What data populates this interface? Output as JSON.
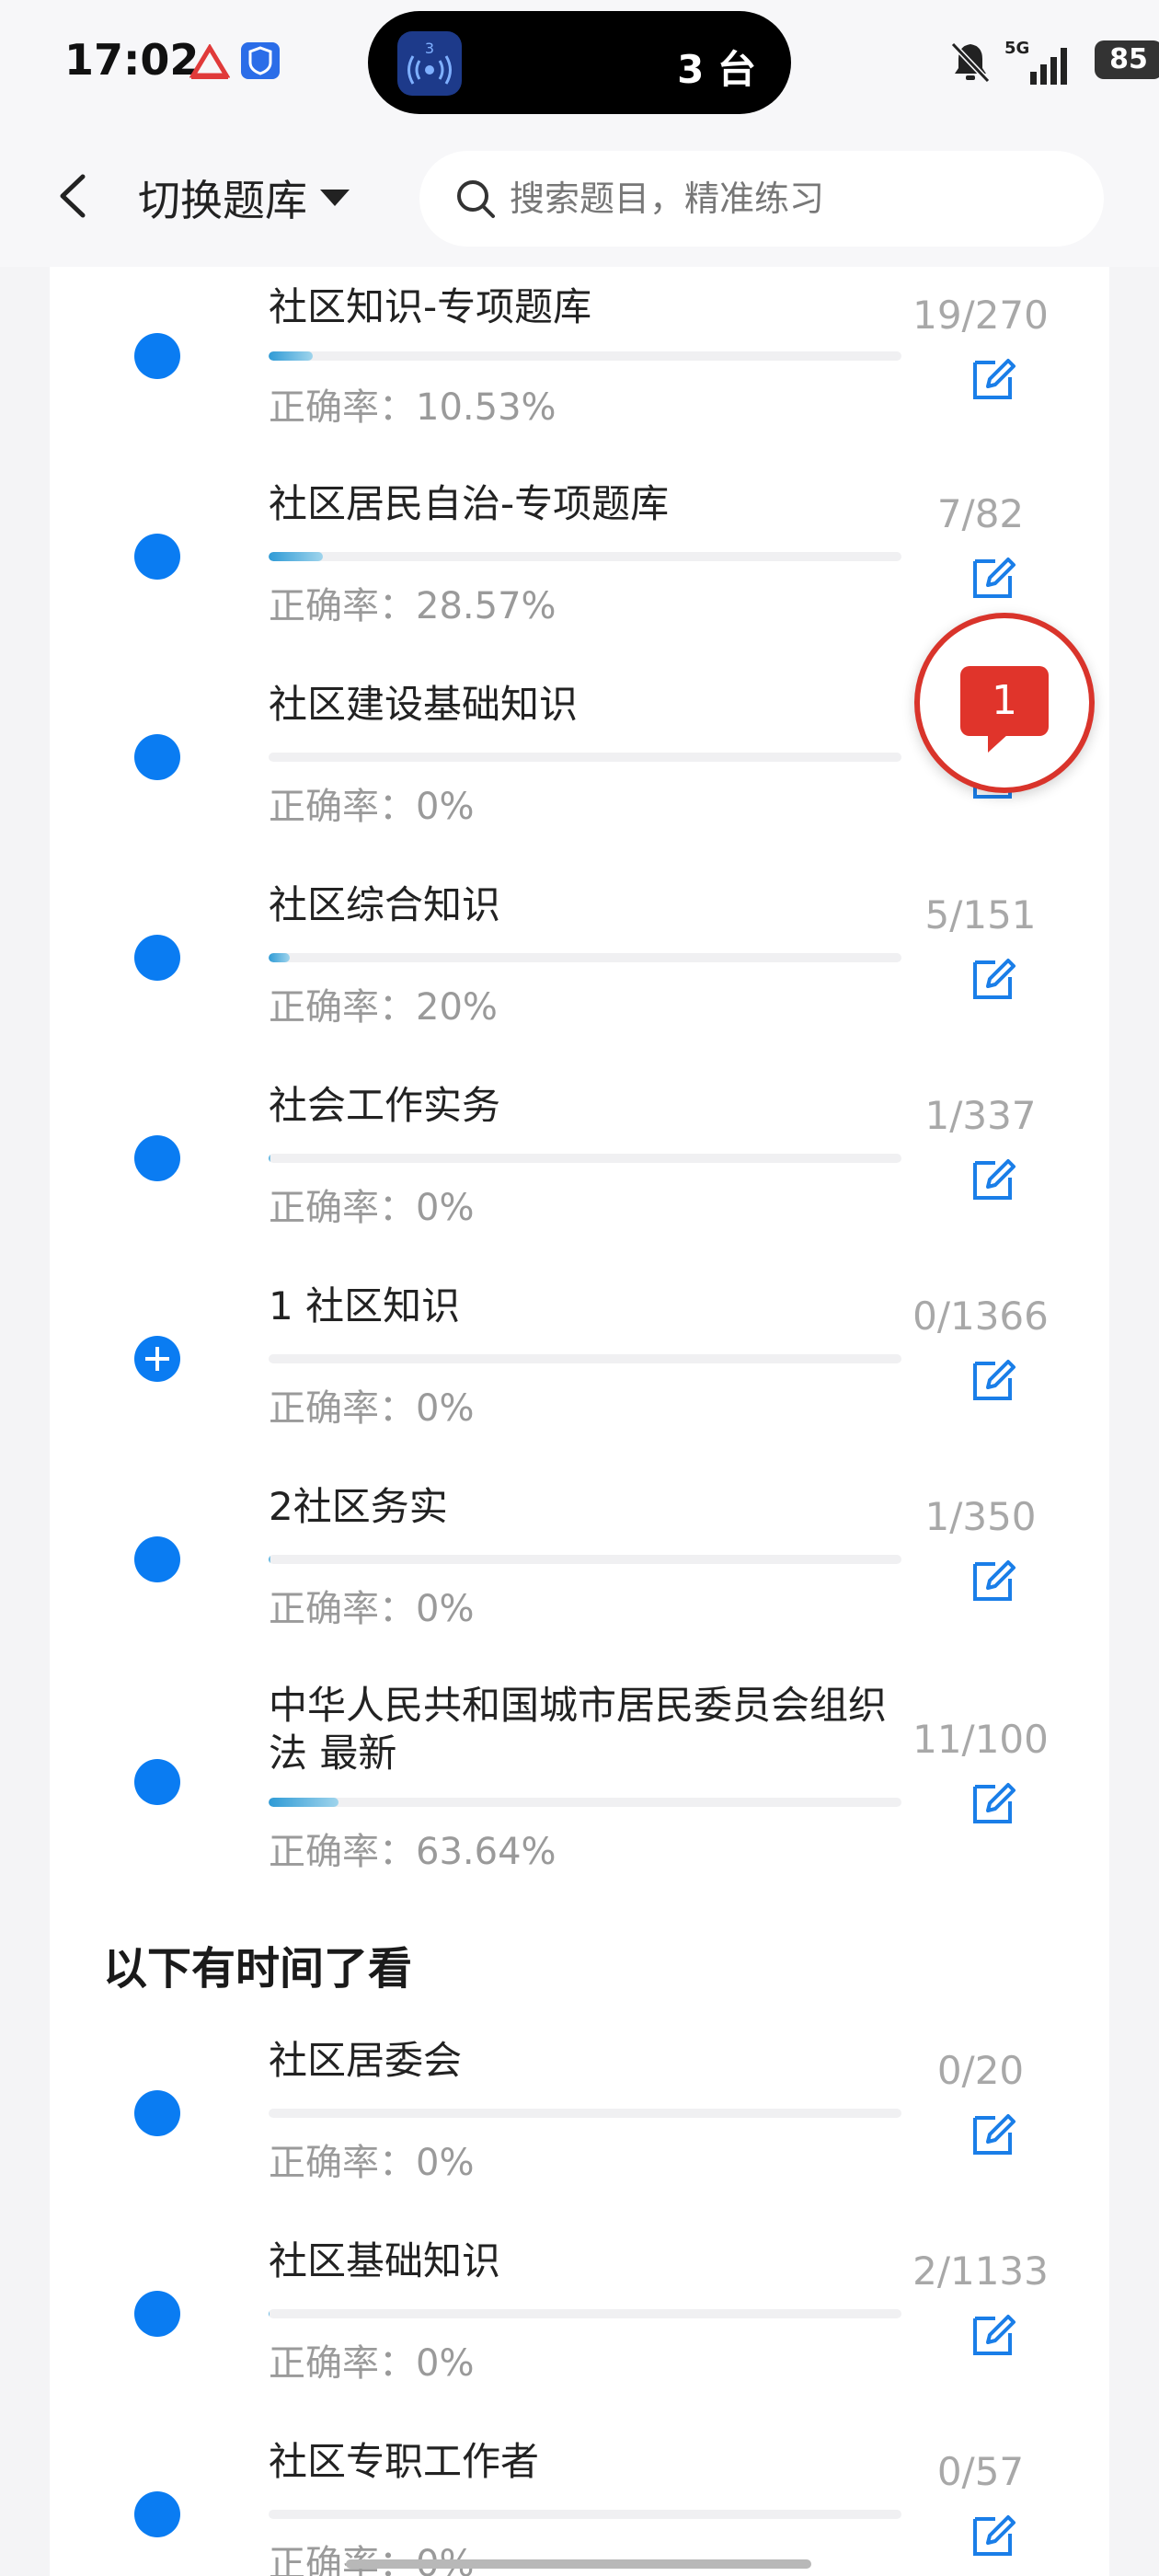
{
  "status_bar": {
    "time": "17:02",
    "island_badge": "3",
    "island_count": "3 台",
    "network": "5G",
    "battery": "85"
  },
  "header": {
    "switch_label": "切换题库",
    "search_placeholder": "搜索题目，精准练习"
  },
  "accuracy_prefix": "正确率：",
  "items": [
    {
      "name": "社区知识-专项题库",
      "accuracy": "10.53%",
      "count": "19/270",
      "progress": 0.0704
    },
    {
      "name": "社区居民自治-专项题库",
      "accuracy": "28.57%",
      "count": "7/82",
      "progress": 0.0854
    },
    {
      "name": "社区建设基础知识",
      "accuracy": "0%",
      "count": "",
      "progress": 0
    },
    {
      "name": "社区综合知识",
      "accuracy": "20%",
      "count": "5/151",
      "progress": 0.0331
    },
    {
      "name": "社会工作实务",
      "accuracy": "0%",
      "count": "1/337",
      "progress": 0.003
    },
    {
      "name": "1 社区知识",
      "accuracy": "0%",
      "count": "0/1366",
      "progress": 0,
      "expandable": true
    },
    {
      "name": "2社区务实",
      "accuracy": "0%",
      "count": "1/350",
      "progress": 0.0029
    },
    {
      "name": "中华人民共和国城市居民委员会组织法 最新",
      "accuracy": "63.64%",
      "count": "11/100",
      "progress": 0.11
    }
  ],
  "section_title": "以下有时间了看",
  "items2": [
    {
      "name": "社区居委会",
      "accuracy": "0%",
      "count": "0/20",
      "progress": 0
    },
    {
      "name": "社区基础知识",
      "accuracy": "0%",
      "count": "2/1133",
      "progress": 0.0018
    },
    {
      "name": "社区专职工作者",
      "accuracy": "0%",
      "count": "0/57",
      "progress": 0
    }
  ],
  "fab_badge": "1",
  "colors": {
    "accent": "#0a7cf2",
    "badge": "#e0342b"
  }
}
